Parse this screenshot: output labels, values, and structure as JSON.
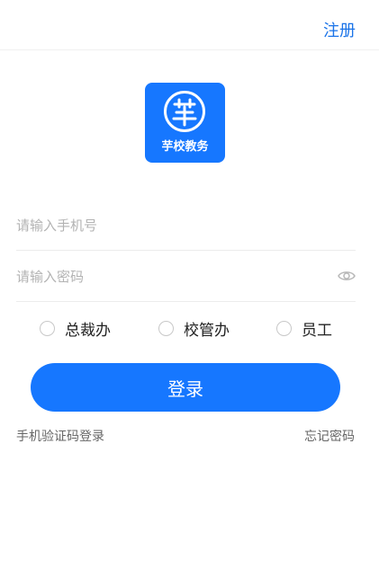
{
  "header": {
    "register_label": "注册"
  },
  "logo": {
    "text": "芋校教务",
    "icon": "yu-character-circle-icon",
    "bg_color": "#1677ff"
  },
  "form": {
    "phone_placeholder": "请输入手机号",
    "phone_value": "",
    "password_placeholder": "请输入密码",
    "password_value": "",
    "password_toggle_icon": "eye-icon"
  },
  "roles": {
    "items": [
      {
        "label": "总裁办",
        "selected": false
      },
      {
        "label": "校管办",
        "selected": false
      },
      {
        "label": "员工",
        "selected": false
      }
    ]
  },
  "actions": {
    "login_label": "登录",
    "sms_login_label": "手机验证码登录",
    "forgot_password_label": "忘记密码"
  },
  "colors": {
    "accent": "#1677ff",
    "link": "#1a73e8"
  }
}
